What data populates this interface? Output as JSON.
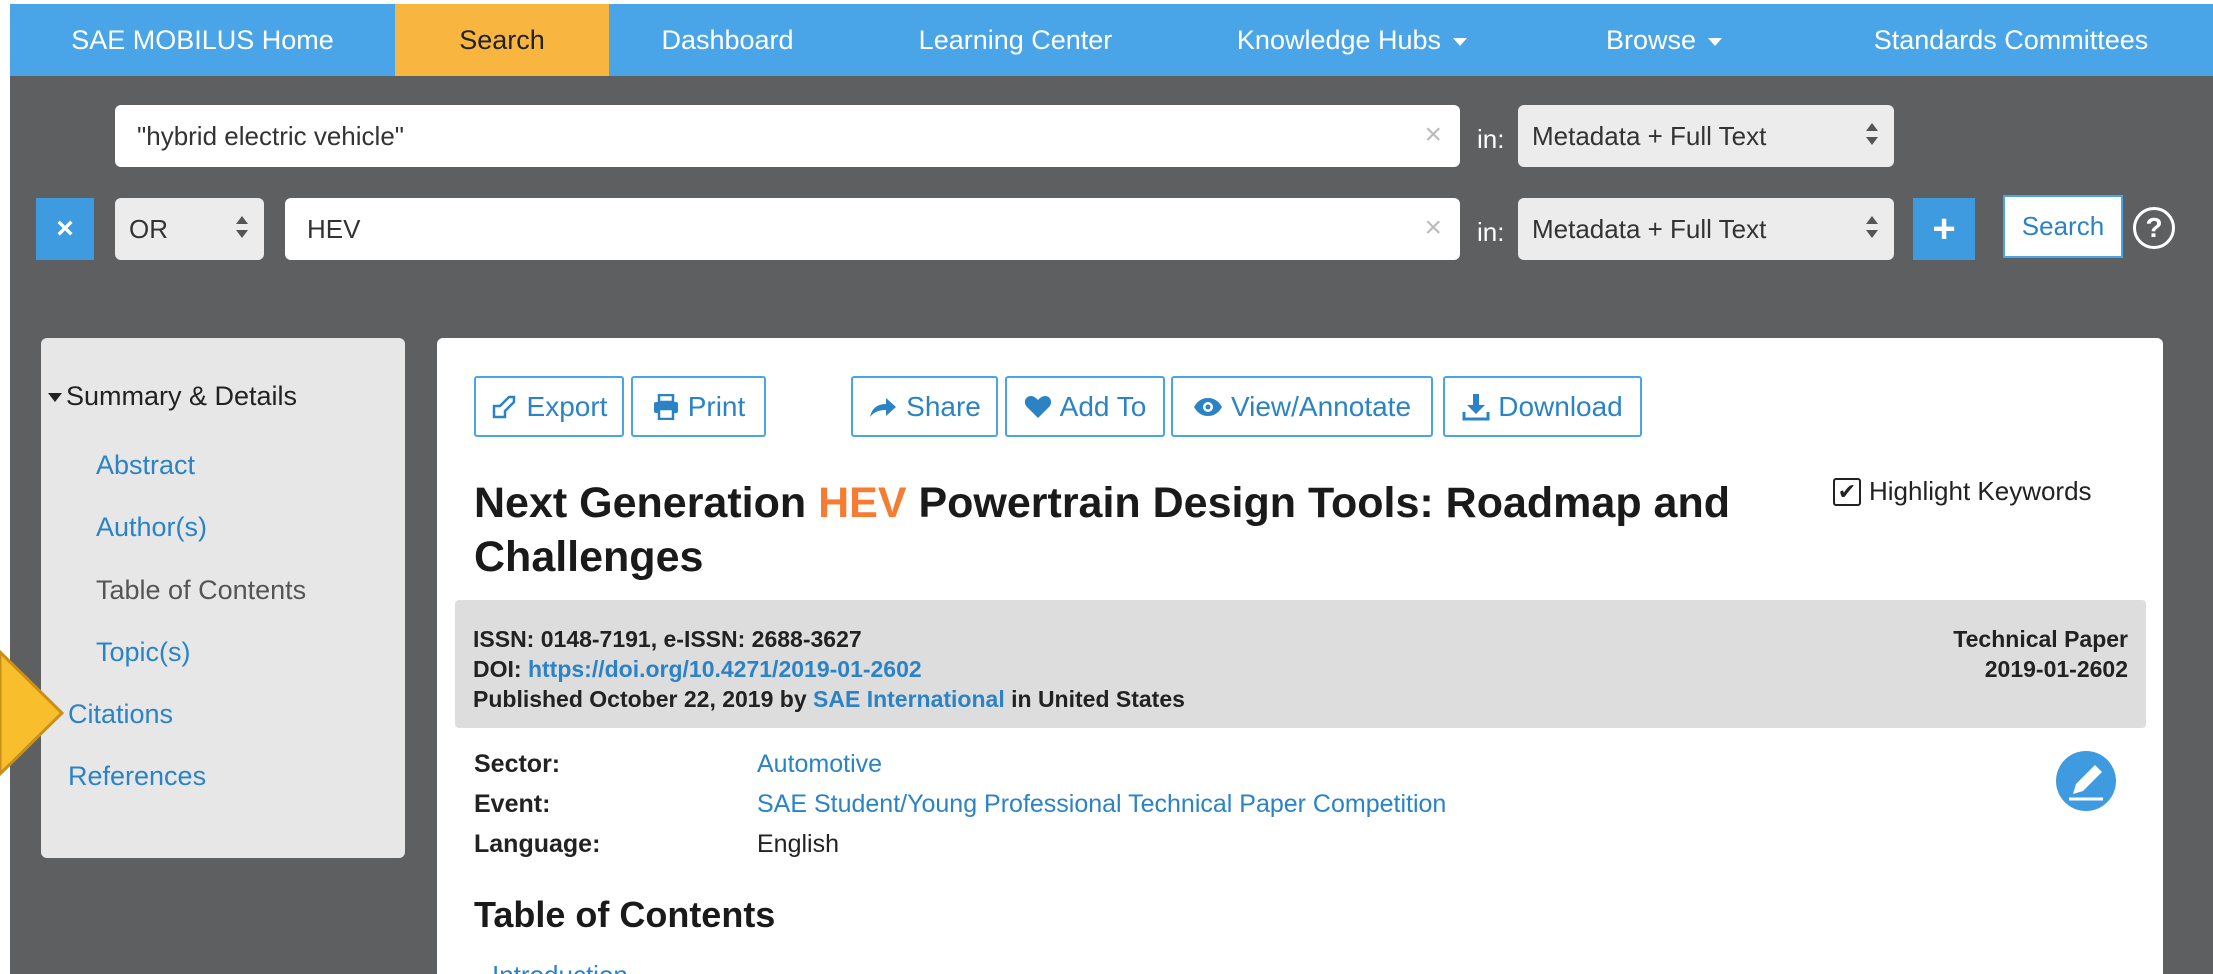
{
  "nav": {
    "items": [
      {
        "label": "SAE MOBILUS Home"
      },
      {
        "label": "Search"
      },
      {
        "label": "Dashboard"
      },
      {
        "label": "Learning Center"
      },
      {
        "label": "Knowledge Hubs"
      },
      {
        "label": "Browse"
      },
      {
        "label": "Standards Committees"
      }
    ]
  },
  "search": {
    "row1": {
      "value": "\"hybrid electric vehicle\"",
      "in_label": "in:",
      "scope": "Metadata + Full Text"
    },
    "row2": {
      "operator": "OR",
      "value": "HEV",
      "in_label": "in:",
      "scope": "Metadata + Full Text"
    },
    "search_label": "Search",
    "help": "?",
    "remove": "×",
    "add": "+",
    "clear": "×"
  },
  "sidebar": {
    "section": "Summary & Details",
    "items": [
      {
        "label": "Abstract"
      },
      {
        "label": "Author(s)"
      },
      {
        "label": "Table of Contents"
      },
      {
        "label": "Topic(s)"
      }
    ],
    "citations": "Citations",
    "references": "References"
  },
  "toolbar": {
    "export": "Export",
    "print": "Print",
    "share": "Share",
    "add_to": "Add To",
    "view_annotate": "View/Annotate",
    "download": "Download"
  },
  "paper": {
    "title_pre": "Next Generation ",
    "title_hl": "HEV",
    "title_post": " Powertrain Design Tools: Roadmap and Challenges",
    "highlight_label": "Highlight Keywords",
    "issn": "ISSN: 0148-7191, e-ISSN: 2688-3627",
    "doi_label": "DOI: ",
    "doi_link": "https://doi.org/10.4271/2019-01-2602",
    "published_pre": "Published October 22, 2019 by ",
    "publisher": "SAE International",
    "published_post": " in United States",
    "type": "Technical Paper",
    "number": "2019-01-2602",
    "sector_label": "Sector:",
    "sector": "Automotive",
    "event_label": "Event:",
    "event": "SAE Student/Young Professional Technical Paper Competition",
    "language_label": "Language:",
    "language": "English",
    "toc_heading": "Table of Contents",
    "toc_first": "Introduction"
  },
  "colors": {
    "nav_blue": "#4AA5E8",
    "active_orange": "#F8B53F",
    "link_blue": "#2B83C6",
    "highlight": "#F57C32",
    "search_bg": "#5E5F61"
  }
}
